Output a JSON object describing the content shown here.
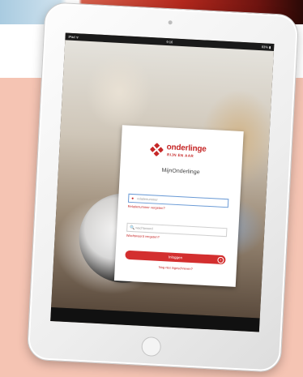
{
  "statusbar": {
    "carrier": "iPad ᯤ",
    "time": "9:16",
    "battery": "83% ▮"
  },
  "login": {
    "brand_name": "onderlinge",
    "brand_sub": "RIJN EN AAR",
    "title": "MijnOnderlinge",
    "username_placeholder": "relatienummer",
    "forgot_username": "Relatienummer vergeten?",
    "password_placeholder": "wachtwoord",
    "forgot_password": "Wachtwoord vergeten?",
    "login_label": "Inloggen",
    "register_label": "Nog niet ingeschreven?"
  },
  "icons": {
    "user": "user-icon",
    "lock": "lock-icon",
    "arrow": "arrow-right-icon"
  },
  "colors": {
    "brand_red": "#d32f2f",
    "background_band": "#f5c4b3"
  }
}
